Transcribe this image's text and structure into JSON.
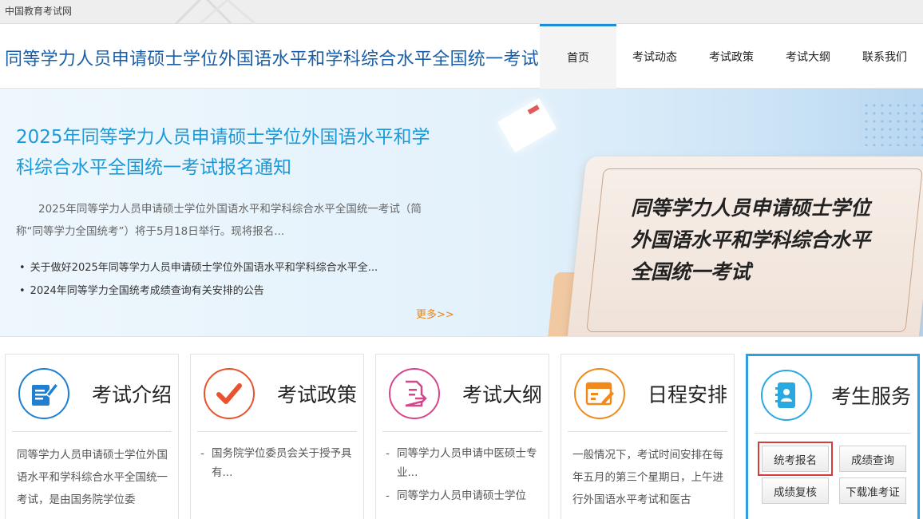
{
  "topbar": {
    "site_name": "中国教育考试网"
  },
  "header": {
    "title": "同等学力人员申请硕士学位外国语水平和学科综合水平全国统一考试",
    "nav": [
      "首页",
      "考试动态",
      "考试政策",
      "考试大纲",
      "联系我们"
    ],
    "active_nav": "首页"
  },
  "banner": {
    "headline": "2025年同等学力人员申请硕士学位外国语水平和学科综合水平全国统一考试报名通知",
    "summary": "2025年同等学力人员申请硕士学位外国语水平和学科综合水平全国统一考试（简称“同等学力全国统考”）将于5月18日举行。现将报名...",
    "links": [
      "关于做好2025年同等学力人员申请硕士学位外国语水平和学科综合水平全...",
      "2024年同等学力全国统考成绩查询有关安排的公告"
    ],
    "more": "更多>>",
    "board_lines": [
      "同等学力人员申请硕士学位",
      "外国语水平和学科综合水平",
      "全国统一考试"
    ]
  },
  "cards": [
    {
      "title": "考试介绍",
      "icon": "document-pen-icon",
      "color": "#1f7fd0",
      "body": "同等学力人员申请硕士学位外国语水平和学科综合水平全国统一考试，是由国务院学位委"
    },
    {
      "title": "考试政策",
      "icon": "checkmark-icon",
      "color": "#e8522f",
      "items": [
        "国务院学位委员会关于授予具有..."
      ]
    },
    {
      "title": "考试大纲",
      "icon": "file-export-icon",
      "color": "#d6468a",
      "items": [
        "同等学力人员申请中医硕士专业...",
        "同等学力人员申请硕士学位"
      ]
    },
    {
      "title": "日程安排",
      "icon": "calendar-edit-icon",
      "color": "#f08a1c",
      "body": "一般情况下，考试时间安排在每年五月的第三个星期日，上午进行外国语水平考试和医古"
    },
    {
      "title": "考生服务",
      "icon": "contact-book-icon",
      "color": "#2aa8e0",
      "buttons": [
        "统考报名",
        "成绩查询",
        "成绩复核",
        "下载准考证"
      ]
    }
  ]
}
